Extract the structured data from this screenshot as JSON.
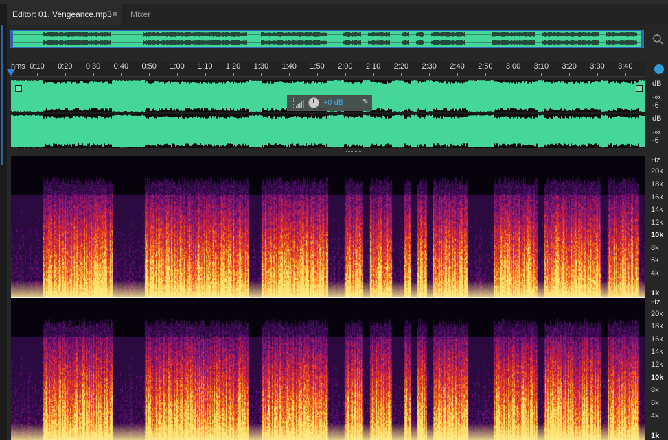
{
  "tabs": [
    {
      "label": "Editor: 01. Vengeance.mp3",
      "active": true,
      "menu_icon": "hamburger-menu-icon"
    },
    {
      "label": "Mixer",
      "active": false
    }
  ],
  "ruler": {
    "unit": "hms",
    "ticks": [
      "0:10",
      "0:20",
      "0:30",
      "0:40",
      "0:50",
      "1:00",
      "1:10",
      "1:20",
      "1:30",
      "1:40",
      "1:50",
      "2:00",
      "2:10",
      "2:20",
      "2:30",
      "2:40",
      "2:50",
      "3:00",
      "3:10",
      "3:20",
      "3:30",
      "3:40"
    ]
  },
  "hud": {
    "volume": "+0 dB",
    "icons": [
      "volume-bars-icon",
      "volume-knob-icon",
      "pin-icon"
    ]
  },
  "db_scale": {
    "unit": "dB",
    "labels": [
      "-∞",
      "-6"
    ]
  },
  "hz_scale": {
    "unit": "Hz",
    "labels": [
      "20k",
      "18k",
      "16k",
      "14k",
      "12k",
      "10k",
      "8k",
      "6k",
      "4k",
      "1k"
    ],
    "bold": [
      "10k",
      "1k"
    ]
  },
  "colors": {
    "waveform_bg": "#45d699",
    "waveform_fg": "#0d0d0d",
    "selection_accent": "#2c64a8",
    "hud_value": "#3ea7e8"
  }
}
